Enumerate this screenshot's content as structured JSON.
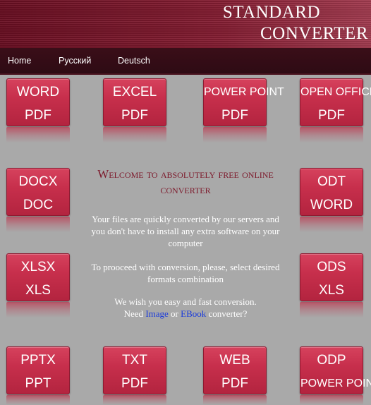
{
  "header": {
    "title_line1": "STANDARD",
    "title_line2": "CONVERTER"
  },
  "nav": {
    "items": [
      "Home",
      "Русский",
      "Deutsch"
    ]
  },
  "tiles": [
    {
      "top": "WORD",
      "bottom": "PDF"
    },
    {
      "top": "EXCEL",
      "bottom": "PDF"
    },
    {
      "top": "POWER POINT",
      "bottom": "PDF"
    },
    {
      "top": "OPEN OFFICE",
      "bottom": "PDF"
    },
    {
      "top": "DOCX",
      "bottom": "DOC"
    },
    {
      "top": "ODT",
      "bottom": "WORD"
    },
    {
      "top": "XLSX",
      "bottom": "XLS"
    },
    {
      "top": "ODS",
      "bottom": "XLS"
    },
    {
      "top": "PPTX",
      "bottom": "PPT"
    },
    {
      "top": "TXT",
      "bottom": "PDF"
    },
    {
      "top": "WEB",
      "bottom": "PDF"
    },
    {
      "top": "ODP",
      "bottom": "POWER POINT"
    }
  ],
  "welcome": {
    "heading": "Welcome to absolutely free online converter",
    "p1": "Your files are quickly converted by our servers and you don't have to install any extra software on your computer",
    "p2": "To prooceed with conversion, please, select desired formats combination",
    "p3_line1": "We wish you easy and fast conversion.",
    "p3_need": "Need",
    "p3_link1": "Image",
    "p3_or": "or",
    "p3_link2": "EBook",
    "p3_end": "converter?"
  },
  "colors": {
    "header_bg": "#7e1a2e",
    "nav_bg": "#2e0b14",
    "page_bg": "#a9a9a9",
    "tile_bg": "#c72f4c",
    "heading_color": "#7d1a2c",
    "link_color": "#1a3bdb"
  }
}
